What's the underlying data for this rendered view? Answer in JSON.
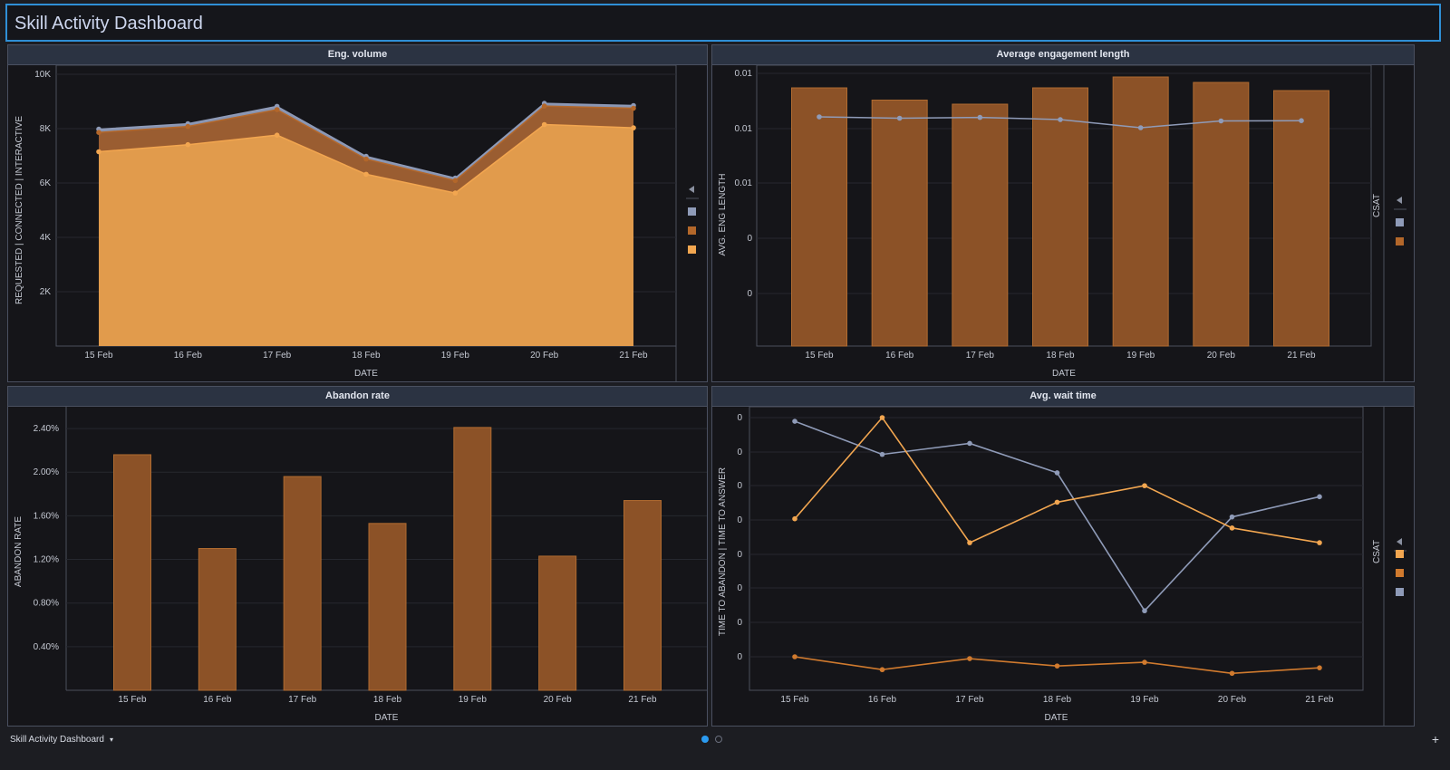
{
  "dashboard": {
    "title": "Skill Activity Dashboard",
    "footer_label": "Skill Activity Dashboard",
    "footer_caret": "▾",
    "add_label": "+"
  },
  "colors": {
    "interactive": "#8f9bb8",
    "connected": "#b3672a",
    "requested": "#f2a650",
    "bar": "#8c5227",
    "bar_edge": "#b06b30",
    "csat_line": "#8f9bb8",
    "abandon_line": "#d07a2e",
    "answer_line": "#f2a650"
  },
  "panels": {
    "volume": {
      "title": "Eng. volume",
      "xlabel": "DATE",
      "ylabel_parts": [
        "REQUESTED",
        "|",
        "CONNECTED",
        "|",
        "INTERACTIVE"
      ],
      "legend_icon": "collapse-triangle-icon"
    },
    "engagement": {
      "title": "Average engagement length",
      "xlabel": "DATE",
      "ylabel": "AVG. ENG LENGTH",
      "y2label": "CSAT",
      "legend_icon": "collapse-triangle-icon"
    },
    "abandon": {
      "title": "Abandon rate",
      "xlabel": "DATE",
      "ylabel": "ABANDON RATE"
    },
    "wait": {
      "title": "Avg. wait time",
      "xlabel": "DATE",
      "ylabel_parts": [
        "TIME TO ABANDON",
        "|",
        "TIME TO ANSWER"
      ],
      "y2label": "CSAT",
      "legend_icon": "collapse-triangle-icon"
    }
  },
  "chart_data": [
    {
      "id": "volume",
      "type": "area",
      "categories": [
        "15 Feb",
        "16 Feb",
        "17 Feb",
        "18 Feb",
        "19 Feb",
        "20 Feb",
        "21 Feb"
      ],
      "ylim": [
        0,
        10000
      ],
      "yticks": [
        2000,
        4000,
        6000,
        8000,
        10000
      ],
      "ytick_labels": [
        "2K",
        "4K",
        "6K",
        "8K",
        "10K"
      ],
      "series": [
        {
          "key": "interactive",
          "values": [
            7980,
            8180,
            8820,
            6980,
            6180,
            8930,
            8850
          ]
        },
        {
          "key": "connected",
          "values": [
            7860,
            8080,
            8700,
            6880,
            6090,
            8830,
            8750
          ]
        },
        {
          "key": "requested",
          "values": [
            7150,
            7410,
            7760,
            6320,
            5630,
            8150,
            8030
          ]
        }
      ]
    },
    {
      "id": "engagement",
      "type": "bar",
      "categories": [
        "15 Feb",
        "16 Feb",
        "17 Feb",
        "18 Feb",
        "19 Feb",
        "20 Feb",
        "21 Feb"
      ],
      "ytick_labels": [
        "0",
        "0",
        "0.01",
        "0.01",
        "0.01"
      ],
      "bars": [
        0.95,
        0.905,
        0.89,
        0.95,
        0.99,
        0.97,
        0.94
      ],
      "csat": [
        0.91,
        0.905,
        0.908,
        0.9,
        0.87,
        0.895,
        0.896
      ]
    },
    {
      "id": "abandon",
      "type": "bar",
      "categories": [
        "15 Feb",
        "16 Feb",
        "17 Feb",
        "18 Feb",
        "19 Feb",
        "20 Feb",
        "21 Feb"
      ],
      "ylim": [
        0,
        2.6
      ],
      "yticks": [
        0.4,
        0.8,
        1.2,
        1.6,
        2.0,
        2.4
      ],
      "ytick_labels": [
        "0.40%",
        "0.80%",
        "1.20%",
        "1.60%",
        "2.00%",
        "2.40%"
      ],
      "values": [
        2.16,
        1.3,
        1.96,
        1.53,
        2.41,
        1.23,
        1.74
      ]
    },
    {
      "id": "wait",
      "type": "line",
      "categories": [
        "15 Feb",
        "16 Feb",
        "17 Feb",
        "18 Feb",
        "19 Feb",
        "20 Feb",
        "21 Feb"
      ],
      "ytick_labels": [
        "0",
        "0",
        "0",
        "0",
        "0",
        "0",
        "0",
        "0"
      ],
      "series": [
        {
          "key": "csat_line",
          "values": [
            0.99,
            0.81,
            0.87,
            0.71,
            -0.04,
            0.47,
            0.58
          ]
        },
        {
          "key": "answer_line",
          "values": [
            0.46,
            1.01,
            0.33,
            0.55,
            0.64,
            0.41,
            0.33
          ]
        },
        {
          "key": "abandon_line",
          "values": [
            -0.29,
            -0.36,
            -0.3,
            -0.34,
            -0.32,
            -0.38,
            -0.35
          ]
        }
      ]
    }
  ]
}
